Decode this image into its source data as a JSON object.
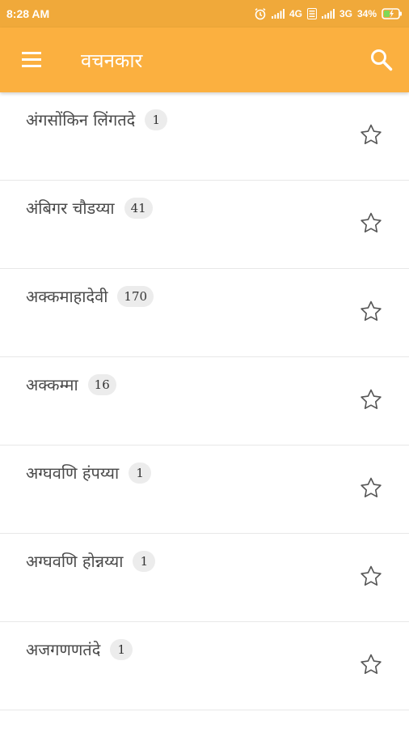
{
  "status_bar": {
    "time": "8:28 AM",
    "network_1": "4G",
    "network_2": "3G",
    "battery": "34%",
    "icons": [
      "alarm-icon",
      "signal-icon",
      "volte-icon",
      "signal-icon",
      "battery-charging-icon"
    ]
  },
  "app_bar": {
    "title": "वचनकार",
    "menu_icon": "menu-icon",
    "search_icon": "search-icon",
    "color": "#fbb040"
  },
  "list": {
    "items": [
      {
        "name": "अंगसोंकिन लिंगतदे",
        "count": "1"
      },
      {
        "name": "अंबिगर चौडय्या",
        "count": "41"
      },
      {
        "name": "अक्कमाहादेवी",
        "count": "170"
      },
      {
        "name": "अक्कम्मा",
        "count": "16"
      },
      {
        "name": "अग्घवणि हंपय्या",
        "count": "1"
      },
      {
        "name": "अग्घवणि होन्नय्या",
        "count": "1"
      },
      {
        "name": "अजगणणतंदे",
        "count": "1"
      }
    ],
    "favorite_icon": "star-outline-icon"
  }
}
